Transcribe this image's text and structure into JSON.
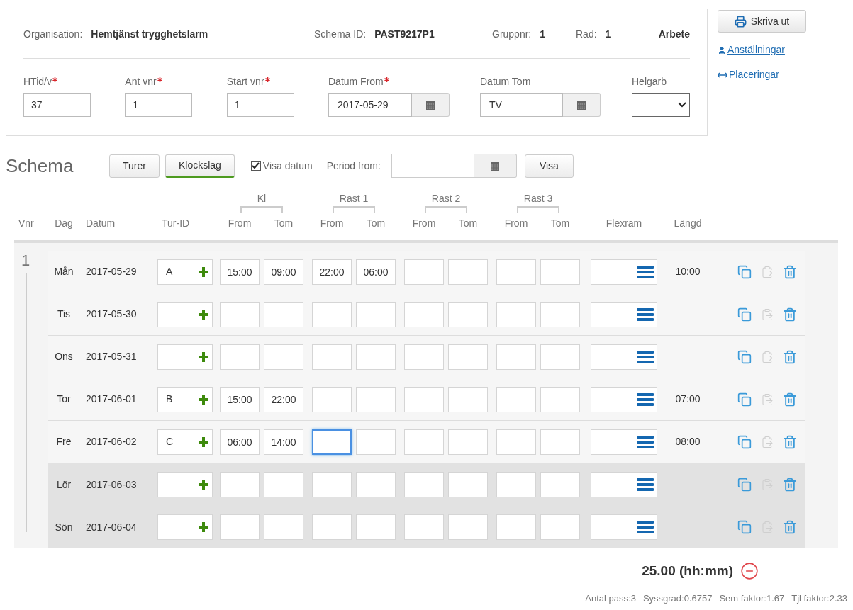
{
  "header": {
    "info": [
      {
        "label": "Organisation:",
        "value": "Hemtjänst trygghetslarm"
      },
      {
        "label": "Schema ID:",
        "value": "PAST9217P1"
      },
      {
        "label": "Gruppnr:",
        "value": "1"
      },
      {
        "label": "Rad:",
        "value": "1"
      }
    ],
    "type_label": "Arbete",
    "fields": [
      {
        "kind": "text",
        "label": "HTid/v",
        "required": true,
        "value": "37"
      },
      {
        "kind": "text",
        "label": "Ant vnr",
        "required": true,
        "value": "1"
      },
      {
        "kind": "text",
        "label": "Start vnr",
        "required": true,
        "value": "1"
      },
      {
        "kind": "date",
        "label": "Datum From",
        "required": true,
        "value": "2017-05-29"
      },
      {
        "kind": "date",
        "label": "Datum Tom",
        "required": false,
        "value": "TV"
      },
      {
        "kind": "select",
        "label": "Helgarb",
        "required": false
      }
    ]
  },
  "side": {
    "print_button": "Skriva ut",
    "links": [
      {
        "kind": "user",
        "label": "Anställningar"
      },
      {
        "kind": "arrows",
        "label": "Placeringar"
      }
    ]
  },
  "schema": {
    "title": "Schema",
    "tabs": [
      {
        "label": "Turer",
        "selected": false
      },
      {
        "label": "Klockslag",
        "selected": true
      }
    ],
    "show_dates": {
      "label": "Visa datum",
      "checked": true
    },
    "period_label": "Period from:",
    "show_button": "Visa",
    "groups": [
      {
        "label": "Kl",
        "from": "From",
        "tom": "Tom"
      },
      {
        "label": "Rast 1",
        "from": "From",
        "tom": "Tom"
      },
      {
        "label": "Rast 2",
        "from": "From",
        "tom": "Tom"
      },
      {
        "label": "Rast 3",
        "from": "From",
        "tom": "Tom"
      }
    ],
    "columns": {
      "vnr": "Vnr",
      "day": "Dag",
      "date": "Datum",
      "tur": "Tur-ID",
      "flex": "Flexram",
      "length": "Längd"
    },
    "week": "1",
    "rows": [
      {
        "day": "Mån",
        "date": "2017-05-29",
        "tur": "A",
        "weekend": false,
        "paste_enabled": false,
        "slots": [
          {
            "from": "15:00",
            "tom": "09:00",
            "focused": false
          },
          {
            "from": "22:00",
            "tom": "06:00",
            "focused": false
          }
        ],
        "length": "10:00"
      },
      {
        "day": "Tis",
        "date": "2017-05-30",
        "weekend": false,
        "paste_enabled": false,
        "slots": []
      },
      {
        "day": "Ons",
        "date": "2017-05-31",
        "weekend": false,
        "paste_enabled": false,
        "slots": []
      },
      {
        "day": "Tor",
        "date": "2017-06-01",
        "tur": "B",
        "weekend": false,
        "paste_enabled": false,
        "slots": [
          {
            "from": "15:00",
            "tom": "22:00",
            "focused": false
          }
        ],
        "length": "07:00"
      },
      {
        "day": "Fre",
        "date": "2017-06-02",
        "tur": "C",
        "weekend": false,
        "paste_enabled": false,
        "slots": [
          {
            "from": "06:00",
            "tom": "14:00",
            "focused": false
          },
          {
            "focused": true
          }
        ],
        "length": "08:00"
      },
      {
        "day": "Lör",
        "date": "2017-06-03",
        "weekend": true,
        "paste_enabled": false,
        "slots": []
      },
      {
        "day": "Sön",
        "date": "2017-06-04",
        "weekend": true,
        "paste_enabled": false,
        "slots": []
      }
    ],
    "total": "25.00 (hh:mm)",
    "stats": [
      "Antal pass:3",
      "Syssgrad:0.6757",
      "Sem faktor:1.67",
      "Tjl faktor:2.33"
    ]
  }
}
